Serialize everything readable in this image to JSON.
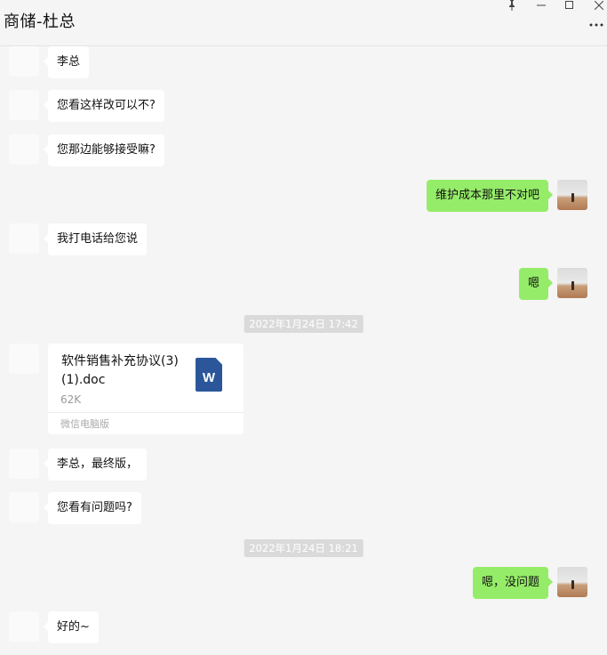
{
  "window": {
    "title": "商储-杜总",
    "pin_icon": "pin-icon",
    "minimize_icon": "minimize-icon",
    "maximize_icon": "maximize-icon",
    "close_icon": "close-icon",
    "more_icon": "more-icon"
  },
  "messages": {
    "m1": "李总",
    "m2": "您看这样改可以不?",
    "m3": "您那边能够接受嘛?",
    "m4": "维护成本那里不对吧",
    "m5": "我打电话给您说",
    "m6": "嗯",
    "t1": "2022年1月24日 17:42",
    "file": {
      "name": "软件销售补充协议(3)(1).doc",
      "size": "62K",
      "source": "微信电脑版",
      "icon_letter": "W"
    },
    "m7": "李总，最终版，",
    "m8": "您看有问题吗?",
    "t2": "2022年1月24日 18:21",
    "m9": "嗯，没问题",
    "m10": "好的~"
  },
  "colors": {
    "sent_bubble": "#95ec69",
    "received_bubble": "#ffffff",
    "background": "#f5f5f5",
    "word_icon": "#2b579a"
  }
}
